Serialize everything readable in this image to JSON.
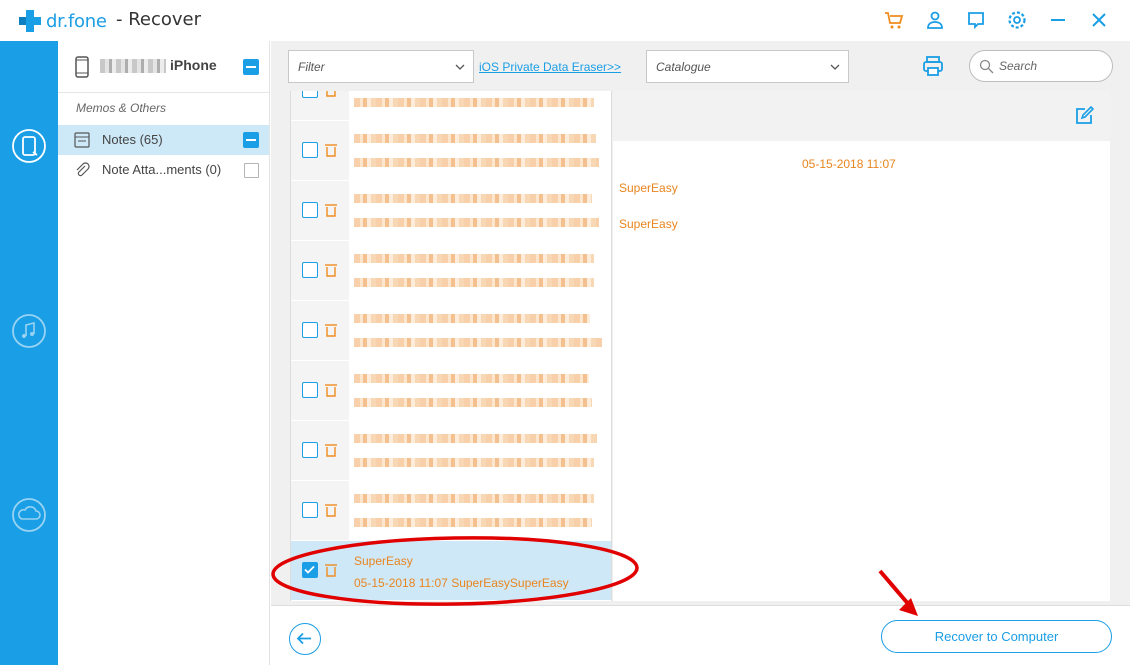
{
  "app": {
    "brand": "dr.fone",
    "title": "- Recover",
    "brand_color": "#1a9ee5",
    "accent_color": "#e8851e"
  },
  "titlebar_icons": [
    "cart-icon",
    "user-icon",
    "feedback-icon",
    "settings-icon",
    "minimize-icon",
    "close-icon"
  ],
  "rail": {
    "items": [
      "phone-recover-icon",
      "itunes-recover-icon",
      "icloud-recover-icon"
    ]
  },
  "device": {
    "name": "iPhone"
  },
  "categories": {
    "section": "Memos & Others",
    "items": [
      {
        "label": "Notes (65)",
        "selected": true,
        "checked": "partial"
      },
      {
        "label": "Note Atta...ments (0)",
        "selected": false,
        "checked": false
      }
    ]
  },
  "toolbar": {
    "filter_value": "Filter",
    "eraser_link": "iOS Private Data Eraser>>",
    "catalogue_value": "Catalogue",
    "search_placeholder": "Search"
  },
  "notes": {
    "blurred_count": 8,
    "selected_note": {
      "title": "SuperEasy",
      "meta": "05-15-2018 11:07   SuperEasySuperEasy",
      "checked": true
    }
  },
  "detail": {
    "date": "05-15-2018 11:07",
    "line1": "SuperEasy",
    "line2": "SuperEasy"
  },
  "footer": {
    "recover_label": "Recover to Computer"
  }
}
